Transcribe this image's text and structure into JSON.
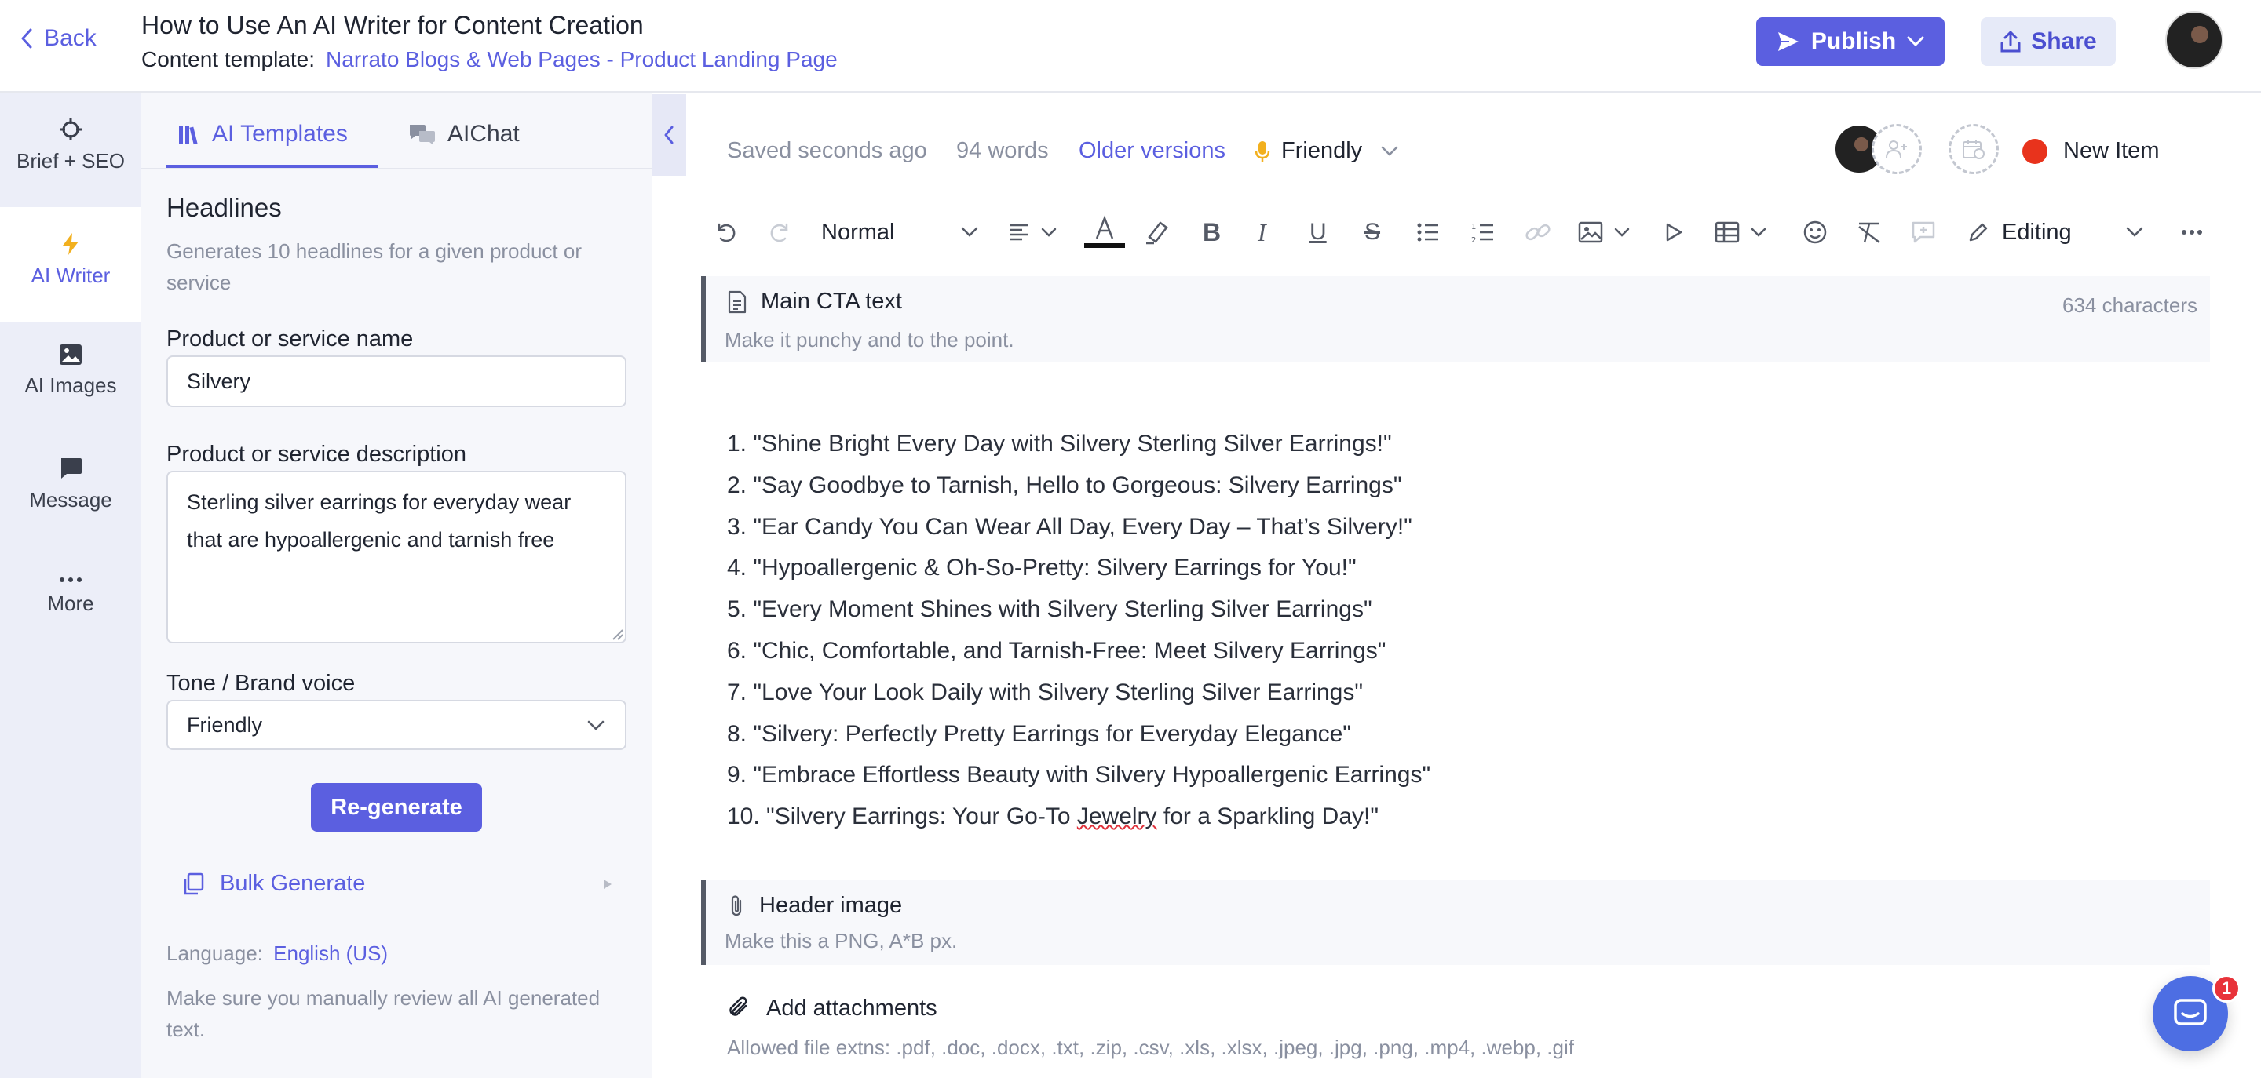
{
  "header": {
    "back_label": "Back",
    "title": "How to Use An AI Writer for Content Creation",
    "template_label": "Content template:",
    "template_link": "Narrato Blogs & Web Pages - Product Landing Page",
    "publish_label": "Publish",
    "share_label": "Share"
  },
  "rail": {
    "items": [
      {
        "label": "Brief + SEO",
        "icon": "crosshair-icon"
      },
      {
        "label": "AI Writer",
        "icon": "lightning-icon"
      },
      {
        "label": "AI Images",
        "icon": "image-icon"
      },
      {
        "label": "Message",
        "icon": "message-icon"
      },
      {
        "label": "More",
        "icon": "more-icon"
      }
    ]
  },
  "panel": {
    "tabs": [
      {
        "label": "AI Templates"
      },
      {
        "label": "AIChat"
      }
    ],
    "section_title": "Headlines",
    "section_desc": "Generates 10 headlines for a given product or service",
    "product_name_label": "Product or service name",
    "product_name_value": "Silvery",
    "product_desc_label": "Product or service description",
    "product_desc_value": "Sterling silver earrings for everyday wear that are hypoallergenic and tarnish free",
    "tone_label": "Tone / Brand voice",
    "tone_value": "Friendly",
    "regenerate_label": "Re-generate",
    "bulk_generate_label": "Bulk Generate",
    "language_label": "Language:",
    "language_value": "English (US)",
    "review_note": "Make sure you manually review all AI generated text."
  },
  "editor": {
    "saved_status": "Saved seconds ago",
    "word_count": "94 words",
    "older_versions": "Older versions",
    "tone": "Friendly",
    "status_label": "New Item",
    "status_color": "#e8331c",
    "toolbar": {
      "style_value": "Normal",
      "mode_value": "Editing"
    },
    "cta_block": {
      "title": "Main CTA text",
      "hint": "Make it punchy and to the point.",
      "char_count": "634 characters"
    },
    "headlines": [
      "1. \"Shine Bright Every Day with Silvery Sterling Silver Earrings!\"",
      "2. \"Say Goodbye to Tarnish, Hello to Gorgeous: Silvery Earrings\"",
      "3. \"Ear Candy You Can Wear All Day, Every Day – That’s Silvery!\"",
      "4. \"Hypoallergenic & Oh-So-Pretty: Silvery Earrings for You!\"",
      "5. \"Every Moment Shines with Silvery Sterling Silver Earrings\"",
      "6. \"Chic, Comfortable, and Tarnish-Free: Meet Silvery Earrings\"",
      "7. \"Love Your Look Daily with Silvery Sterling Silver Earrings\"",
      "8. \"Silvery: Perfectly Pretty Earrings for Everyday Elegance\"",
      "9. \"Embrace Effortless Beauty with Silvery Hypoallergenic Earrings\""
    ],
    "headline_10_prefix": "10. \"Silvery Earrings: Your Go-To ",
    "headline_10_marked": "Jewelry",
    "headline_10_suffix": " for a Sparkling Day!\"",
    "image_block": {
      "title": "Header image",
      "hint": "Make this a PNG, A*B px."
    },
    "attachments": {
      "title": "Add attachments",
      "hint": "Allowed file extns: .pdf, .doc, .docx, .txt, .zip, .csv, .xls, .xlsx, .jpeg, .jpg, .png, .mp4, .webp, .gif"
    }
  },
  "chat_widget": {
    "badge": "1"
  },
  "colors": {
    "accent": "#5b5fe0",
    "rail_bg": "#eceef8",
    "panel_bg": "#f6f7fb"
  }
}
